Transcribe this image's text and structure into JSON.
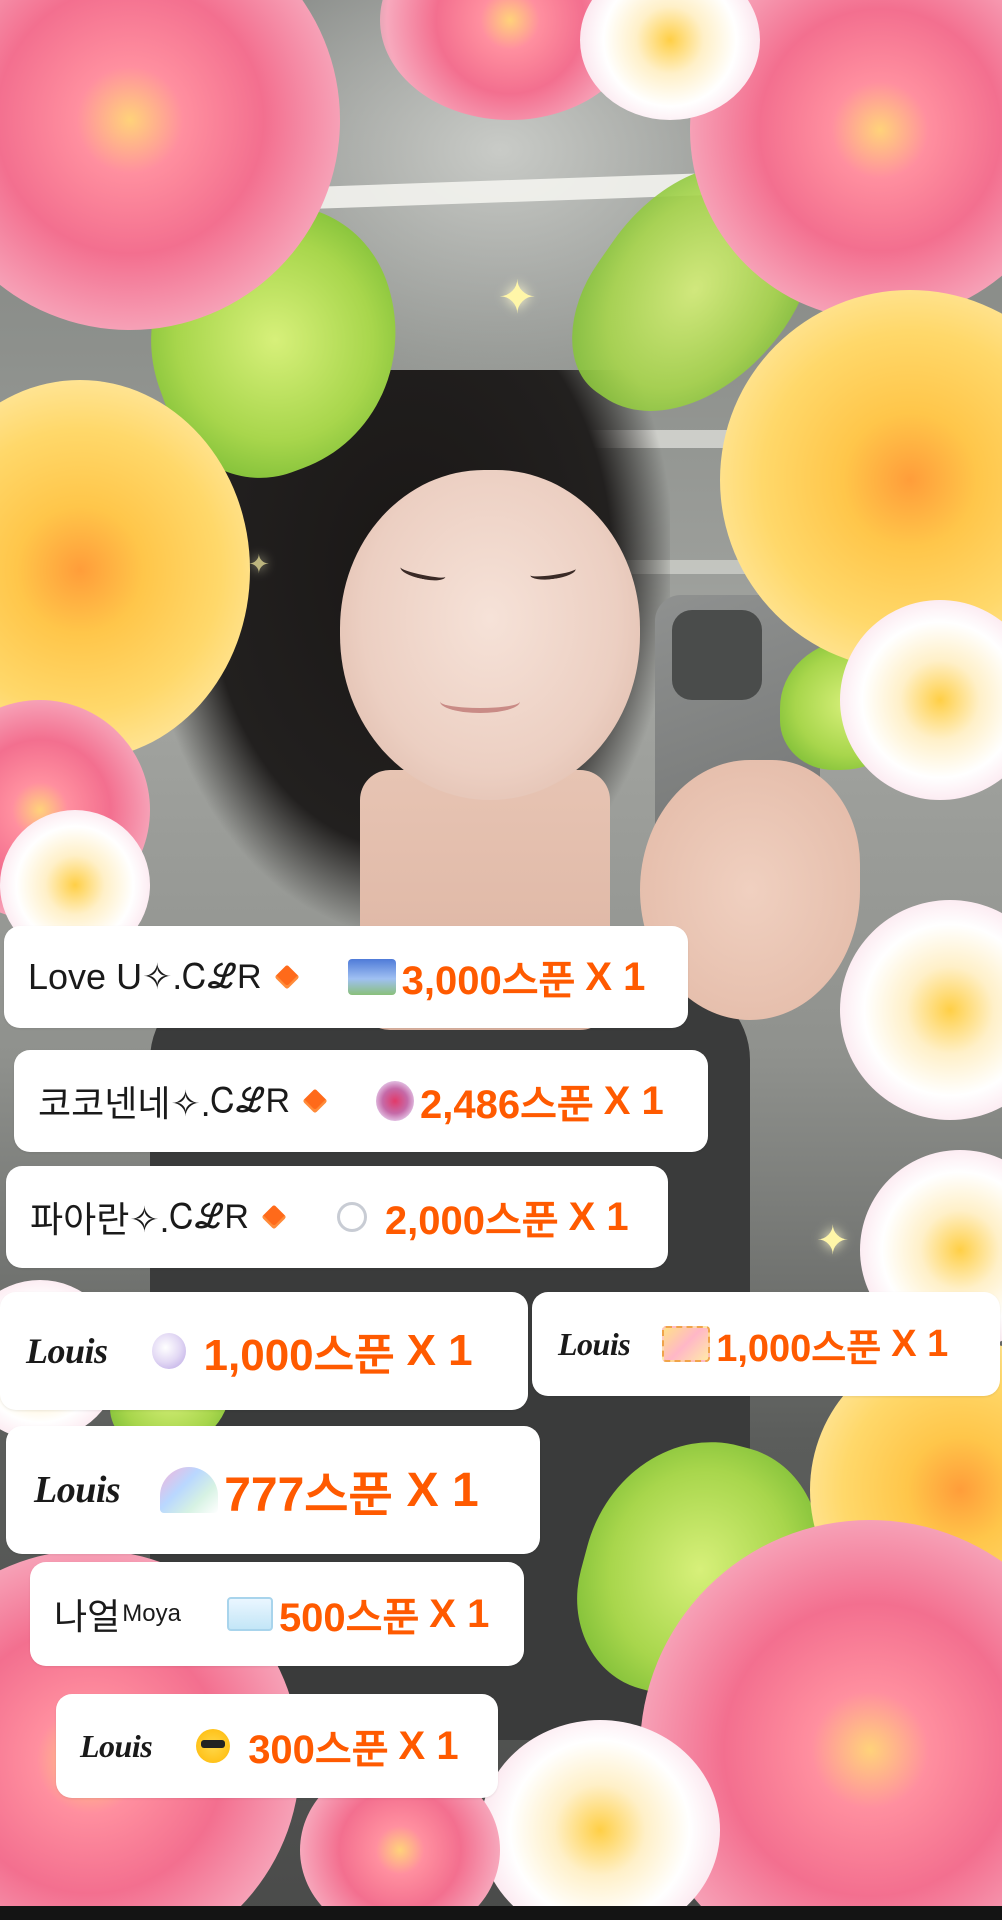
{
  "donations": [
    {
      "sender": "Love U✧.",
      "tag": "ᏟℒR",
      "amount": "3,000스푼",
      "multiplier": "X 1",
      "gift_icon": "palace-sticker-icon"
    },
    {
      "sender": "코코넨네✧.",
      "tag": "ᏟℒR",
      "amount": "2,486스푼",
      "multiplier": "X 1",
      "gift_icon": "heart-wings-sticker-icon"
    },
    {
      "sender": "파아란✧.",
      "tag": "ᏟℒR",
      "amount": "2,000스푼",
      "multiplier": "X 1",
      "gift_icon": "ring-sticker-icon"
    },
    {
      "sender": "Louis",
      "amount": "1,000스푼",
      "multiplier": "X 1",
      "gift_icon": "moon-sticker-icon"
    },
    {
      "sender": "Louis",
      "amount": "1,000스푼",
      "multiplier": "X 1",
      "gift_icon": "flower-frame-sticker-icon"
    },
    {
      "sender": "Louis",
      "amount": "777스푼",
      "multiplier": "X 1",
      "gift_icon": "rainbow-sticker-icon"
    },
    {
      "sender": "나얼",
      "sender_sup": "Moya",
      "amount": "500스푼",
      "multiplier": "X 1",
      "gift_icon": "letter-sticker-icon"
    },
    {
      "sender": "Louis",
      "amount": "300스푼",
      "multiplier": "X 1",
      "gift_icon": "sunglasses-emoji-icon"
    }
  ],
  "colors": {
    "amount": "#ff5a00",
    "badge": "#ff6a1a",
    "card_bg": "#ffffff"
  }
}
